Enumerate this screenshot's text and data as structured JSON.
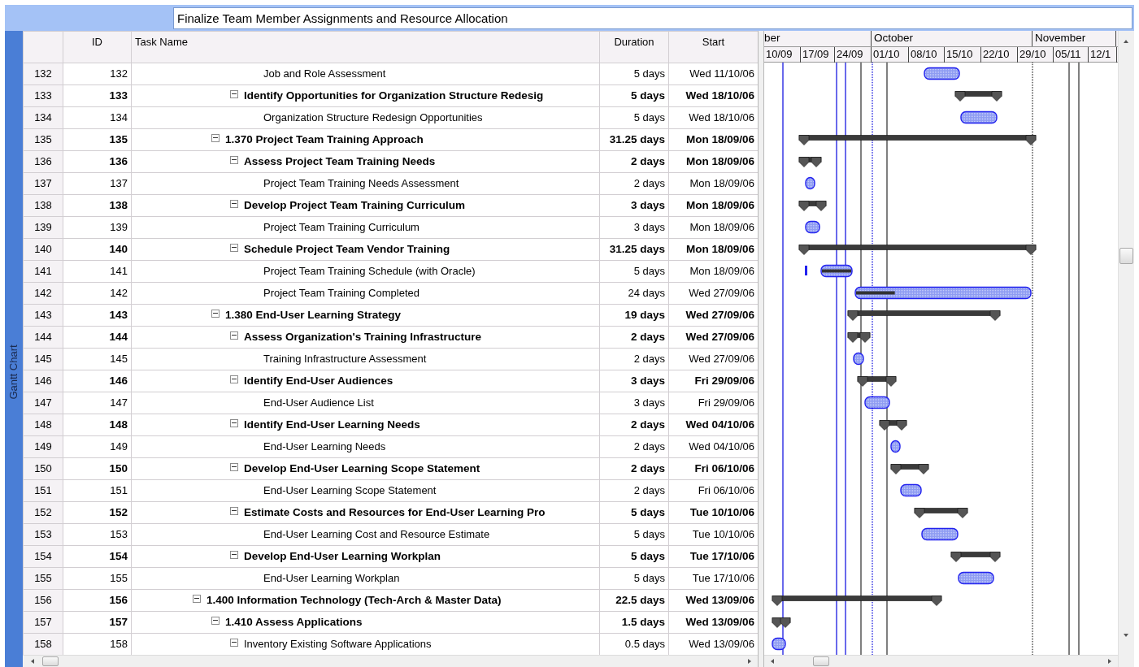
{
  "entry_bar": {
    "value": "Finalize Team Member Assignments and Resource Allocation"
  },
  "side_tab": {
    "label": "Gantt Chart"
  },
  "table": {
    "columns": [
      "ID",
      "Task Name",
      "Duration",
      "Start"
    ],
    "tasks": [
      {
        "children": [
          {
            "children": [
              {
                "children": [
                  {
                    "row": "132",
                    "id": "132",
                    "name": "Job and Role Assessment",
                    "duration": "5 days",
                    "start": "Wed 11/10/06"
                  }
                ]
              },
              {
                "row": "133",
                "id": "133",
                "name": "Identify Opportunities for Organization Structure Redesig",
                "duration": "5 days",
                "start": "Wed 18/10/06",
                "expanded": true,
                "children": [
                  {
                    "row": "134",
                    "id": "134",
                    "name": "Organization Structure Redesign Opportunities",
                    "duration": "5 days",
                    "start": "Wed 18/10/06"
                  }
                ]
              }
            ]
          },
          {
            "row": "135",
            "id": "135",
            "name": "1.370 Project Team Training Approach",
            "duration": "31.25 days",
            "start": "Mon 18/09/06",
            "expanded": true,
            "children": [
              {
                "row": "136",
                "id": "136",
                "name": "Assess Project Team Training Needs",
                "duration": "2 days",
                "start": "Mon 18/09/06",
                "expanded": true,
                "children": [
                  {
                    "row": "137",
                    "id": "137",
                    "name": "Project Team Training Needs Assessment",
                    "duration": "2 days",
                    "start": "Mon 18/09/06"
                  }
                ]
              },
              {
                "row": "138",
                "id": "138",
                "name": "Develop Project Team Training Curriculum",
                "duration": "3 days",
                "start": "Mon 18/09/06",
                "expanded": true,
                "children": [
                  {
                    "row": "139",
                    "id": "139",
                    "name": "Project Team Training Curriculum",
                    "duration": "3 days",
                    "start": "Mon 18/09/06"
                  }
                ]
              },
              {
                "row": "140",
                "id": "140",
                "name": "Schedule Project Team Vendor Training",
                "duration": "31.25 days",
                "start": "Mon 18/09/06",
                "expanded": true,
                "children": [
                  {
                    "row": "141",
                    "id": "141",
                    "name": "Project Team Training Schedule (with Oracle)",
                    "duration": "5 days",
                    "start": "Mon 18/09/06"
                  },
                  {
                    "row": "142",
                    "id": "142",
                    "name": "Project Team Training Completed",
                    "duration": "24 days",
                    "start": "Wed 27/09/06"
                  }
                ]
              }
            ]
          },
          {
            "row": "143",
            "id": "143",
            "name": "1.380 End-User Learning Strategy",
            "duration": "19 days",
            "start": "Wed 27/09/06",
            "expanded": true,
            "children": [
              {
                "row": "144",
                "id": "144",
                "name": "Assess Organization's Training Infrastructure",
                "duration": "2 days",
                "start": "Wed 27/09/06",
                "expanded": true,
                "children": [
                  {
                    "row": "145",
                    "id": "145",
                    "name": "Training Infrastructure Assessment",
                    "duration": "2 days",
                    "start": "Wed 27/09/06"
                  }
                ]
              },
              {
                "row": "146",
                "id": "146",
                "name": "Identify End-User Audiences",
                "duration": "3 days",
                "start": "Fri 29/09/06",
                "expanded": true,
                "children": [
                  {
                    "row": "147",
                    "id": "147",
                    "name": "End-User Audience List",
                    "duration": "3 days",
                    "start": "Fri 29/09/06"
                  }
                ]
              },
              {
                "row": "148",
                "id": "148",
                "name": "Identify End-User Learning Needs",
                "duration": "2 days",
                "start": "Wed 04/10/06",
                "expanded": true,
                "children": [
                  {
                    "row": "149",
                    "id": "149",
                    "name": "End-User Learning Needs",
                    "duration": "2 days",
                    "start": "Wed 04/10/06"
                  }
                ]
              },
              {
                "row": "150",
                "id": "150",
                "name": "Develop End-User Learning Scope Statement",
                "duration": "2 days",
                "start": "Fri 06/10/06",
                "expanded": true,
                "children": [
                  {
                    "row": "151",
                    "id": "151",
                    "name": "End-User Learning Scope Statement",
                    "duration": "2 days",
                    "start": "Fri 06/10/06"
                  }
                ]
              },
              {
                "row": "152",
                "id": "152",
                "name": "Estimate Costs and Resources for End-User Learning Pro",
                "duration": "5 days",
                "start": "Tue 10/10/06",
                "expanded": true,
                "children": [
                  {
                    "row": "153",
                    "id": "153",
                    "name": "End-User Learning Cost and Resource Estimate",
                    "duration": "5 days",
                    "start": "Tue 10/10/06"
                  }
                ]
              },
              {
                "row": "154",
                "id": "154",
                "name": "Develop End-User Learning Workplan",
                "duration": "5 days",
                "start": "Tue 17/10/06",
                "expanded": true,
                "children": [
                  {
                    "row": "155",
                    "id": "155",
                    "name": "End-User Learning Workplan",
                    "duration": "5 days",
                    "start": "Tue 17/10/06"
                  }
                ]
              }
            ]
          }
        ]
      },
      {
        "row": "156",
        "id": "156",
        "name": "1.400 Information Technology (Tech-Arch & Master Data)",
        "duration": "22.5 days",
        "start": "Wed 13/09/06",
        "expanded": true,
        "children": [
          {
            "row": "157",
            "id": "157",
            "name": "1.410 Assess Applications",
            "duration": "1.5 days",
            "start": "Wed 13/09/06",
            "expanded": true,
            "children": [
              {
                "row": "158",
                "id": "158",
                "name": "Inventory Existing Software Applications",
                "duration": "0.5 days",
                "start": "Wed 13/09/06",
                "expanded": true
              }
            ]
          }
        ]
      }
    ]
  },
  "timescale": {
    "months": [
      "ber",
      "October",
      "November"
    ],
    "weeks": [
      "10/09",
      "17/09",
      "24/09",
      "01/10",
      "08/10",
      "15/10",
      "22/10",
      "29/10",
      "05/11",
      "12/1"
    ]
  }
}
